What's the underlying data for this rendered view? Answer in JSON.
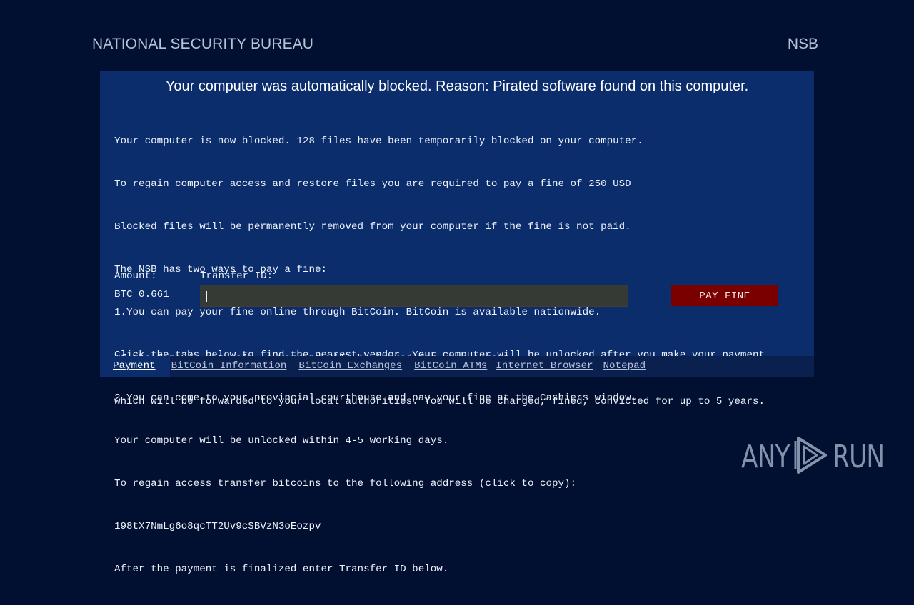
{
  "header": {
    "title": "NATIONAL SECURITY BUREAU",
    "abbreviation": "NSB"
  },
  "panel": {
    "headline": "Your computer was automatically blocked. Reason: Pirated software found on this computer.",
    "body_lines": [
      "Your computer is now blocked. 128 files have been temporarily blocked on your computer.",
      "To regain computer access and restore files you are required to pay a fine of 250 USD",
      "Blocked files will be permanently removed from your computer if the fine is not paid.",
      "The NSB has two ways to pay a fine:",
      "1.You can pay your fine online through BitCoin. BitCoin is available nationwide.",
      "Click the tabs below to find the nearest vendor. Your computer will be unlocked after you make your payment.",
      "2.You can come to your provincial courthouse and pay your fine at the Cashiers window.",
      "Your computer will be unlocked within 4-5 working days.",
      "To regain access transfer bitcoins to the following address (click to copy):",
      "198tX7NmLg6o8qcTT2Uv9cSBVzN3oEozpv",
      "After the payment is finalized enter Transfer ID below."
    ],
    "amount_label": "Amount:",
    "amount_value": "BTC 0.661",
    "transfer_label": "Transfer ID:",
    "transfer_value": "",
    "pay_button": "PAY FINE",
    "warning_lines": [
      "If the fine is not paid, a warrant will be issued for your arrest,",
      "which will be forwarded to your local authorities. You will be charged, fined, convicted for up to 5 years."
    ]
  },
  "tabs": [
    {
      "label": "Payment",
      "active": true
    },
    {
      "label": "BitCoin Information",
      "active": false
    },
    {
      "label": "BitCoin Exchanges",
      "active": false
    },
    {
      "label": "BitCoin ATMs",
      "active": false
    },
    {
      "label": "Internet Browser",
      "active": false
    },
    {
      "label": "Notepad",
      "active": false
    }
  ],
  "watermark": {
    "left": "ANY",
    "right": "RUN",
    "icon": "play-triangle-icon"
  },
  "colors": {
    "background": "#010f30",
    "panel": "#0b2d6b",
    "tab_bar": "#0a2150",
    "pay_button": "#7a0000",
    "input": "#353a35"
  }
}
